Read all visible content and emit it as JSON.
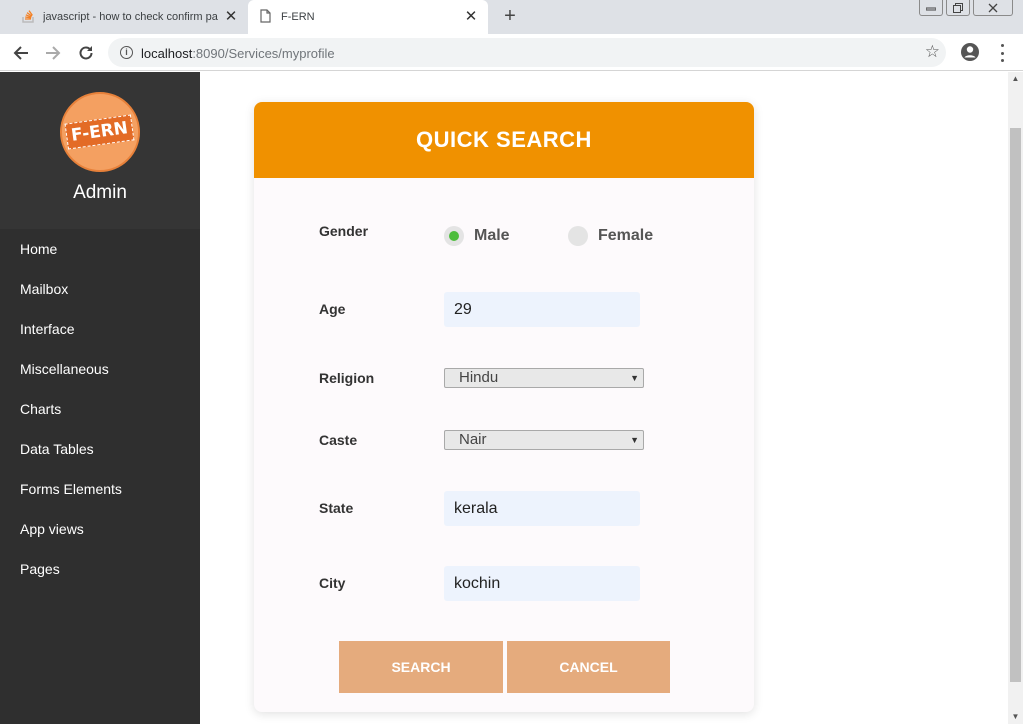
{
  "browser": {
    "tabs": [
      {
        "title": "javascript - how to check confirm pa",
        "icon": "stack-overflow-icon"
      },
      {
        "title": "F-ERN",
        "icon": "page-icon"
      }
    ],
    "url_host": "localhost",
    "url_rest": ":8090/Services/myprofile"
  },
  "sidebar": {
    "logo_text": "F-ERN",
    "user_name": "Admin",
    "items": [
      {
        "label": "Home"
      },
      {
        "label": "Mailbox"
      },
      {
        "label": "Interface"
      },
      {
        "label": "Miscellaneous"
      },
      {
        "label": "Charts"
      },
      {
        "label": "Data Tables"
      },
      {
        "label": "Forms Elements"
      },
      {
        "label": "App views"
      },
      {
        "label": "Pages"
      }
    ]
  },
  "form": {
    "title": "QUICK SEARCH",
    "gender_label": "Gender",
    "gender_options": [
      {
        "label": "Male",
        "checked": true
      },
      {
        "label": "Female",
        "checked": false
      }
    ],
    "age_label": "Age",
    "age_value": "29",
    "religion_label": "Religion",
    "religion_value": "Hindu",
    "caste_label": "Caste",
    "caste_value": "Nair",
    "state_label": "State",
    "state_value": "kerala",
    "city_label": "City",
    "city_value": "kochin",
    "search_label": "SEARCH",
    "cancel_label": "CANCEL"
  },
  "colors": {
    "header_orange": "#f09100",
    "button": "#e5ab7d",
    "sidebar_bg": "#2f2f2f",
    "radio_checked": "#4dbd3c",
    "input_bg": "#edf3fd"
  }
}
